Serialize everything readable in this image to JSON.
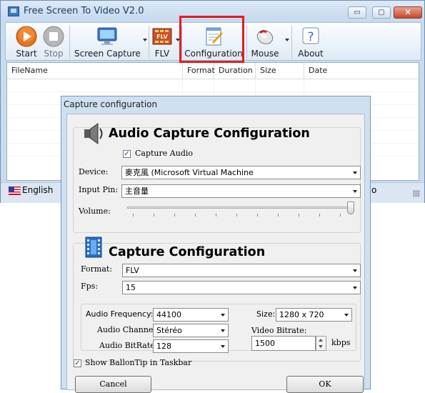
{
  "window": {
    "title": "Free Screen To Video V2.0",
    "controls": {
      "minimize": "▭",
      "maximize": "▢",
      "close": "✕"
    }
  },
  "toolbar": {
    "start": "Start",
    "stop": "Stop",
    "screen_capture": "Screen Capture",
    "flv": "FLV",
    "configuration": "Configuration",
    "mouse": "Mouse",
    "about": "About",
    "flv_icon_text": "FLV"
  },
  "file_list": {
    "columns": [
      "FileName",
      "Format",
      "Duration",
      "Size",
      "Date"
    ]
  },
  "statusbar": {
    "language": "English",
    "partial_text": "o"
  },
  "dialog": {
    "title": "Capture configuration",
    "audio_section": {
      "heading": "Audio Capture Configuration",
      "capture_audio_label": "Capture Audio",
      "capture_audio_checked": true,
      "device_label": "Device:",
      "device_value": "麥克風 (Microsoft Virtual Machine",
      "input_pin_label": "Input Pin:",
      "input_pin_value": "主音量",
      "volume_label": "Volume:",
      "volume_level": 1.0
    },
    "capture_section": {
      "heading": "Capture Configuration",
      "format_label": "Format:",
      "format_value": "FLV",
      "fps_label": "Fps:",
      "fps_value": "15",
      "audio_frequency_label": "Audio Frequency:",
      "audio_frequency_value": "44100",
      "audio_channel_label": "Audio Channel:",
      "audio_channel_value": "Stéréo",
      "audio_bitrate_label": "Audio BitRate:",
      "audio_bitrate_value": "128",
      "size_label": "Size:",
      "size_value": "1280 x 720",
      "video_bitrate_label": "Video Bitrate:",
      "video_bitrate_value": "1500",
      "video_bitrate_unit": "kbps"
    },
    "balloon_tip_label": "Show BallonTip in Taskbar",
    "balloon_tip_checked": true,
    "cancel_button": "Cancel",
    "ok_button": "OK"
  },
  "colors": {
    "highlight": "#e51c1c",
    "start_icon": "#e8731a",
    "stop_icon": "#a9a9a9"
  }
}
